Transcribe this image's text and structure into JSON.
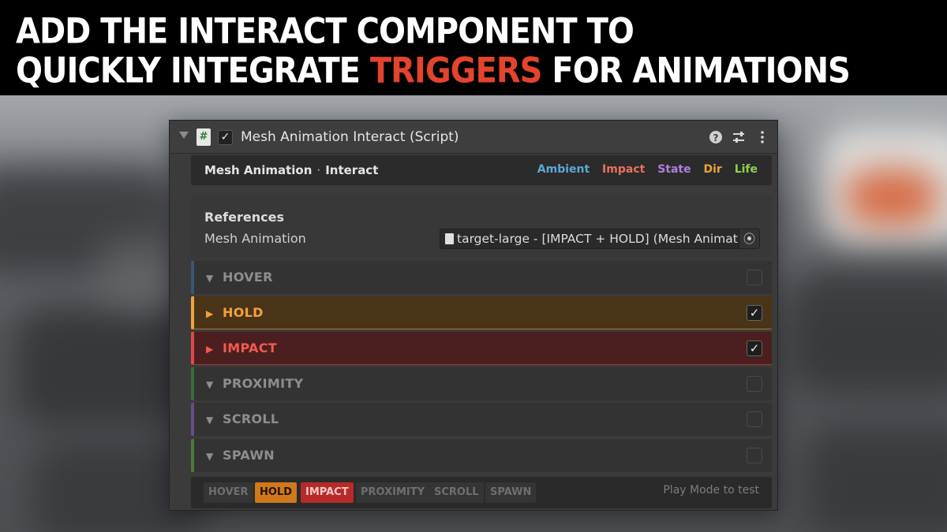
{
  "banner": {
    "line1": "ADD THE INTERACT COMPONENT TO",
    "line2_pre": "QUICKLY INTEGRATE ",
    "line2_highlight": "TRIGGERS",
    "line2_post": " FOR ANIMATIONS",
    "highlight_color": "#e4432d"
  },
  "component": {
    "title": "Mesh Animation Interact (Script)",
    "enabled": true,
    "script_icon": "#",
    "icons": {
      "help": "help-icon",
      "presets": "sliders-icon",
      "more": "kebab-menu-icon"
    }
  },
  "subheader": {
    "name": "Mesh Animation",
    "separator": "·",
    "sub": "Interact",
    "tags": [
      {
        "label": "Ambient",
        "color": "#5aa9d6"
      },
      {
        "label": "Impact",
        "color": "#e8725a"
      },
      {
        "label": "State",
        "color": "#b07fe0"
      },
      {
        "label": "Dir",
        "color": "#e8a33a"
      },
      {
        "label": "Life",
        "color": "#8fd04c"
      }
    ]
  },
  "references": {
    "section": "References",
    "field_label": "Mesh Animation",
    "field_value": "target-large - [IMPACT + HOLD] (Mesh Animation)"
  },
  "triggers": [
    {
      "label": "HOVER",
      "expanded": true,
      "checked": false
    },
    {
      "label": "HOLD",
      "expanded": false,
      "checked": true
    },
    {
      "label": "IMPACT",
      "expanded": false,
      "checked": true
    },
    {
      "label": "PROXIMITY",
      "expanded": true,
      "checked": false
    },
    {
      "label": "SCROLL",
      "expanded": true,
      "checked": false
    },
    {
      "label": "SPAWN",
      "expanded": true,
      "checked": false
    }
  ],
  "footer": {
    "chips": [
      "HOVER",
      "HOLD",
      "IMPACT",
      "PROXIMITY",
      "SCROLL",
      "SPAWN"
    ],
    "status": "Play Mode to test"
  },
  "glyphs": {
    "check": "✓",
    "arrow_down": "▼",
    "arrow_right": "▶",
    "target": "⦿"
  }
}
